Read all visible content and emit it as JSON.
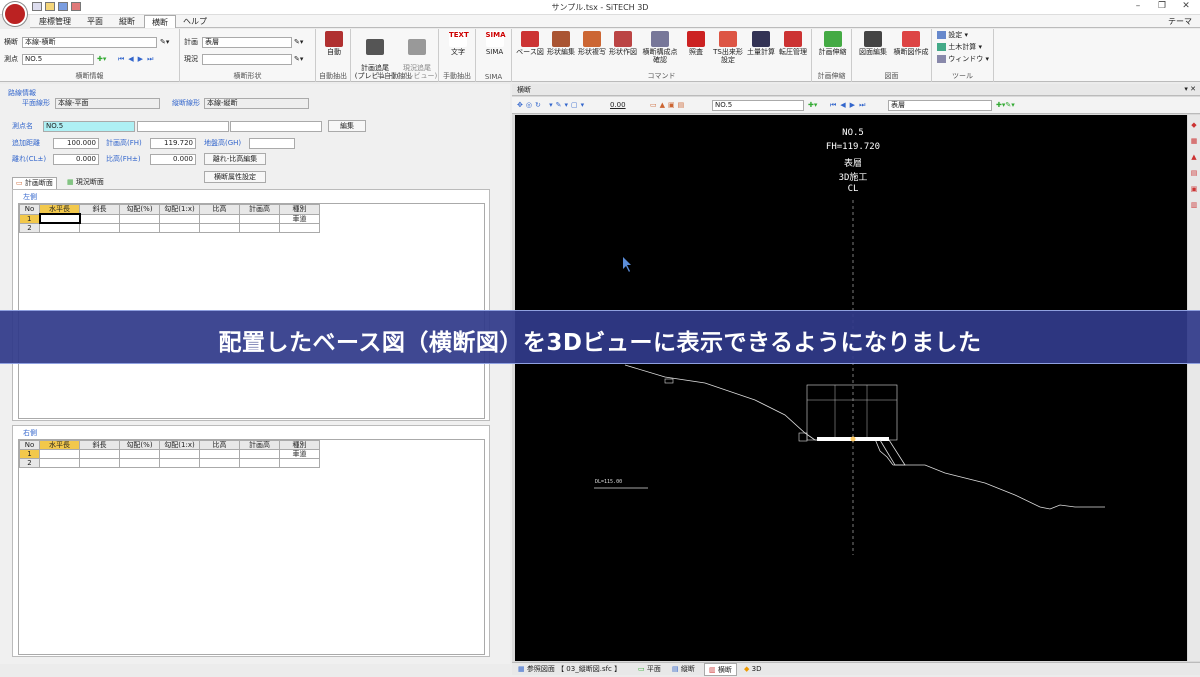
{
  "window": {
    "title": "サンプル.tsx - SiTECH 3D"
  },
  "menu": {
    "items": [
      "座標管理",
      "平面",
      "縦断",
      "横断",
      "ヘルプ"
    ],
    "active": "横断",
    "theme": "テーマ"
  },
  "ribbon": {
    "group1": {
      "label1": "横断",
      "value1": "本線-横断",
      "label2": "測点",
      "value2": "NO.5",
      "caption": "横断情報"
    },
    "group2": {
      "label1": "計画",
      "value1": "表層",
      "label2": "現況",
      "value2": "",
      "caption": "横断形状"
    },
    "auto": {
      "btn": "自動",
      "caption": "自動抽出"
    },
    "semi": {
      "btn1": "計画追尾\n(プレビュー)",
      "btn2": "現況追尾\n(プレビュー)",
      "caption": "半自動抽出"
    },
    "manual": {
      "btn": "文字",
      "caption": "手動抽出",
      "icon_text": "TEXT"
    },
    "sima": {
      "btn": "SIMA",
      "caption": "SIMA",
      "icon_text": "SIMA"
    },
    "command": {
      "buttons": [
        "ベース図",
        "形状編集",
        "形状複写",
        "形状作図",
        "横断構成点\n確認",
        "照査",
        "TS出来形\n設定",
        "土量計算",
        "転圧管理"
      ],
      "caption": "コマンド"
    },
    "plan": {
      "btn": "計画伸縮",
      "caption": "計画伸縮"
    },
    "drawing": {
      "btn1": "図面編集",
      "btn2": "横断図作成",
      "caption": "図面"
    },
    "tools": {
      "items": [
        "設定",
        "土木計算",
        "ウィンドウ"
      ],
      "caption": "ツール"
    }
  },
  "left": {
    "route_section": "路線情報",
    "plane_label": "平面線形",
    "plane_value": "本線-平面",
    "vert_label": "縦断線形",
    "vert_value": "本線-縦断",
    "point_label": "測点名",
    "point_value": "NO.5",
    "edit_btn": "編集",
    "dist_label": "追加距離",
    "dist_value": "100.000",
    "fh_label": "計画高(FH)",
    "fh_value": "119.720",
    "gh_label": "地盤高(GH)",
    "gh_value": "",
    "cl_label": "離れ(CL±)",
    "cl_value": "0.000",
    "ratio_label": "比高(FH±)",
    "ratio_value": "0.000",
    "ratio_btn": "離れ-比高編集",
    "attr_btn": "横断属性設定",
    "tab_plan": "計画断面",
    "tab_current": "現況断面",
    "left_side": "左側",
    "right_side": "右側",
    "columns": [
      "No",
      "水平長",
      "斜長",
      "勾配(%)",
      "勾配(1:x)",
      "比高",
      "計画高",
      "種別"
    ],
    "left_rows": [
      [
        "1",
        "",
        "",
        "",
        "",
        "",
        "",
        "車道"
      ],
      [
        "2",
        "",
        "",
        "",
        "",
        "",
        "",
        ""
      ]
    ],
    "right_rows": [
      [
        "1",
        "",
        "",
        "",
        "",
        "",
        "",
        "車道"
      ],
      [
        "2",
        "",
        "",
        "",
        "",
        "",
        "",
        ""
      ]
    ]
  },
  "right": {
    "panel_title": "横断",
    "zoom": "0.00",
    "station_select": "NO.5",
    "layer_select": "表層",
    "canvas": {
      "lines": [
        "NO.5",
        "FH=119.720",
        "表層",
        "3D施工",
        "CL"
      ],
      "dl_label": "DL=115.00"
    }
  },
  "banner": {
    "text": "配置したベース図（横断図）を3Dビューに表示できるようになりました"
  },
  "statusbar": {
    "tabs": [
      "参照図面 【 03_縦断図.sfc 】",
      "平面",
      "縦断",
      "横断",
      "3D"
    ],
    "active": "横断"
  }
}
